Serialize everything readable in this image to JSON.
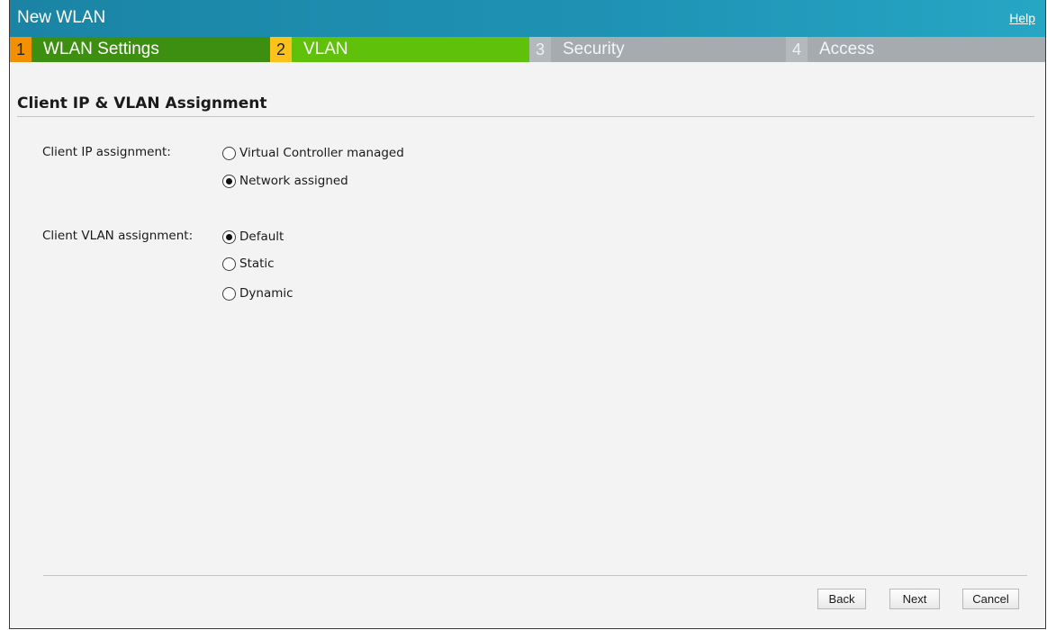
{
  "window": {
    "title": "New WLAN",
    "help_label": "Help"
  },
  "steps": [
    {
      "number": "1",
      "label": "WLAN Settings"
    },
    {
      "number": "2",
      "label": "VLAN"
    },
    {
      "number": "3",
      "label": "Security"
    },
    {
      "number": "4",
      "label": "Access"
    }
  ],
  "section": {
    "heading": "Client IP & VLAN Assignment"
  },
  "client_ip": {
    "label": "Client IP assignment:",
    "options": [
      {
        "label": "Virtual Controller managed",
        "selected": false
      },
      {
        "label": "Network assigned",
        "selected": true
      }
    ]
  },
  "client_vlan": {
    "label": "Client VLAN assignment:",
    "options": [
      {
        "label": "Default",
        "selected": true
      },
      {
        "label": "Static",
        "selected": false
      },
      {
        "label": "Dynamic",
        "selected": false
      }
    ]
  },
  "buttons": {
    "back": "Back",
    "next": "Next",
    "cancel": "Cancel"
  },
  "colors": {
    "titlebar": "#1f93b5",
    "step_done_number": "#f29000",
    "step_done_label": "#3d8f12",
    "step_active_number": "#fcc21c",
    "step_active_label": "#5fc10a",
    "step_inactive": "#a6abb0"
  }
}
